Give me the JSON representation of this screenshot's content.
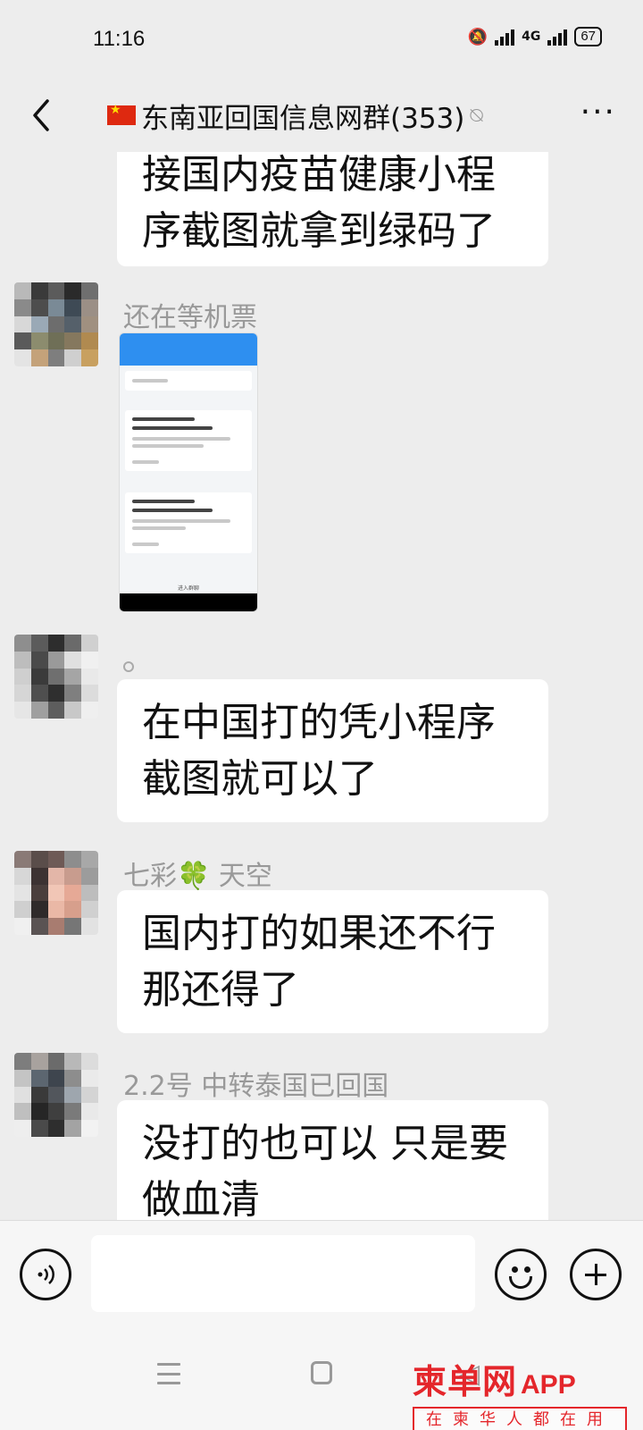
{
  "status_bar": {
    "time": "11:16",
    "network_label": "4G",
    "battery": "67"
  },
  "header": {
    "title": "东南亚回国信息网群(353)"
  },
  "messages": [
    {
      "text_lines": [
        "接国内疫苗健康小程",
        "序截图就拿到绿码了"
      ]
    },
    {
      "sender": "还在等机票"
    },
    {
      "text_lines": [
        "在中国打的凭小程序",
        "截图就可以了"
      ]
    },
    {
      "sender": "七彩🍀 天空",
      "text_lines": [
        "国内打的如果还不行",
        "那还得了"
      ]
    },
    {
      "sender": "2.2号 中转泰国已回国",
      "text_lines": [
        "没打的也可以 只是要",
        "做血清"
      ]
    }
  ],
  "screenshot_thumb": {
    "footer_label": "进入群聊"
  },
  "input": {
    "value": "",
    "placeholder": ""
  },
  "watermark": {
    "brand": "柬单网",
    "app": "APP",
    "slogan": "在柬华人都在用"
  },
  "colors": {
    "background": "#ededed",
    "bubble": "#ffffff",
    "accent_blue": "#2e8ff0",
    "watermark_red": "#e4262b"
  }
}
